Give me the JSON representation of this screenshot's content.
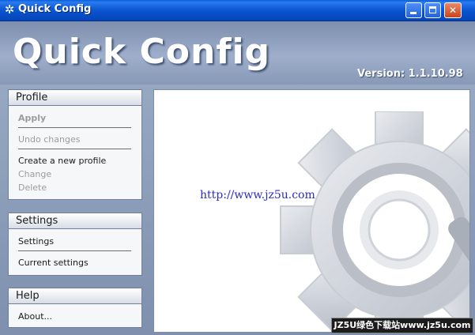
{
  "window": {
    "title": "Quick Config",
    "icon": "gear-icon",
    "controls": {
      "minimize": "",
      "maximize": "",
      "close": "✕"
    }
  },
  "header": {
    "app_title": "Quick Config",
    "version": "Version: 1.1.10.98"
  },
  "profile_panel": {
    "title": "Profile",
    "items": [
      {
        "label": "Apply",
        "enabled": false
      },
      {
        "label": "Undo changes",
        "enabled": false
      },
      {
        "label": "Create a new profile",
        "enabled": true
      },
      {
        "label": "Change",
        "enabled": false
      },
      {
        "label": "Delete",
        "enabled": false
      }
    ]
  },
  "settings_panel": {
    "title": "Settings",
    "items": [
      {
        "label": "Settings",
        "enabled": true
      },
      {
        "label": "Current settings",
        "enabled": true
      }
    ]
  },
  "help_panel": {
    "title": "Help",
    "items": [
      {
        "label": "About...",
        "enabled": true
      }
    ]
  },
  "content": {
    "url_text": "http://www.jz5u.com",
    "graphic": "large-gear-icon"
  },
  "watermark": "JZ5U绿色下载站www.jz5u.com",
  "colors": {
    "titlebar": "#0a55d0",
    "header_bg": "#9eaecb",
    "link": "#2b2bcc",
    "disabled_text": "#9c9c9c"
  }
}
